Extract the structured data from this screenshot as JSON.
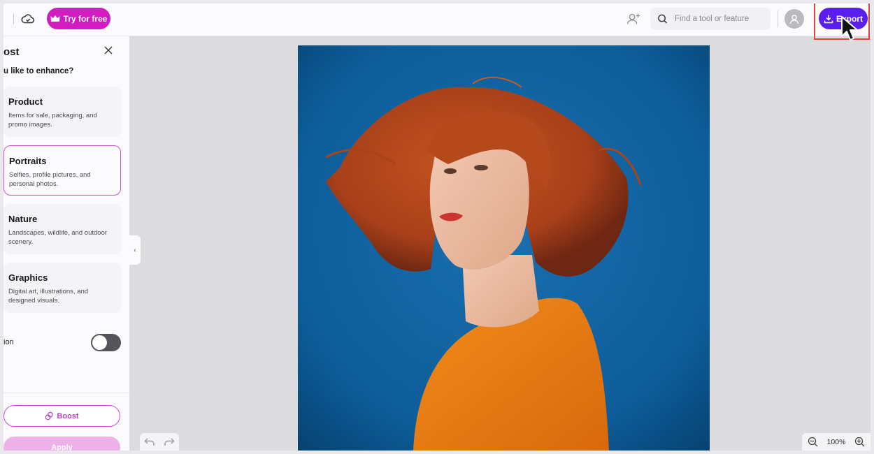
{
  "topbar": {
    "try_label": "Try for free",
    "search_placeholder": "Find a tool or feature",
    "export_label": "Export"
  },
  "panel": {
    "title": "ost",
    "question": "u like to enhance?",
    "categories": [
      {
        "title": "Product",
        "desc": "Items for sale, packaging, and promo images."
      },
      {
        "title": "Portraits",
        "desc": "Selfies, profile pictures, and personal photos."
      },
      {
        "title": "Nature",
        "desc": "Landscapes, wildlife, and outdoor scenery."
      },
      {
        "title": "Graphics",
        "desc": "Digital art, illustrations, and designed visuals."
      }
    ],
    "selected_category": "Portraits",
    "toggle_label": "ion",
    "toggle_on": false,
    "boost_label": "Boost",
    "apply_label": "Apply"
  },
  "canvas": {
    "zoom": "100%"
  },
  "colors": {
    "accent_magenta": "#d21cc0",
    "export_purple": "#5a1ff0",
    "photo_background": "#0d5d9a"
  },
  "icons": [
    "cloud-check-icon",
    "crown-icon",
    "add-user-icon",
    "search-icon",
    "avatar-icon",
    "download-icon",
    "cursor-icon",
    "close-icon",
    "boost-icon",
    "chevron-left-icon",
    "undo-icon",
    "redo-icon",
    "zoom-out-icon",
    "zoom-in-icon"
  ]
}
